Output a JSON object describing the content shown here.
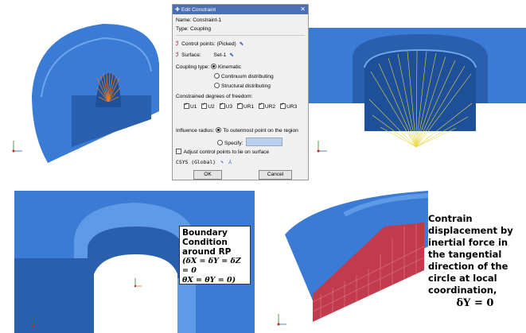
{
  "dialog": {
    "title": "Edit Constraint",
    "close_glyph": "✕",
    "name_label": "Name:",
    "name_value": "Constraint-1",
    "type_label": "Type:",
    "type_value": "Coupling",
    "control_points_label": "Control points:",
    "control_points_value": "(Picked)",
    "surface_label": "Surface:",
    "surface_value": "Set-1",
    "coupling_type_label": "Coupling type:",
    "coupling_options": [
      "Kinematic",
      "Continuum distributing",
      "Structural distributing"
    ],
    "coupling_selected_index": 0,
    "dof_label": "Constrained degrees of freedom:",
    "dof": [
      "U1",
      "U2",
      "U3",
      "UR1",
      "UR2",
      "UR3"
    ],
    "dof_checked": [
      true,
      true,
      true,
      true,
      true,
      true
    ],
    "influence_label": "Influence radius:",
    "influence_option_1": "To outermost point on the region",
    "influence_option_2": "Specify:",
    "influence_selected": 1,
    "adjust_label": "Adjust control points to lie on surface",
    "adjust_checked": false,
    "csys_label": "CSYS (Global)",
    "ok_label": "OK",
    "cancel_label": "Cancel"
  },
  "annotations": {
    "bc_lines": [
      "Boundary",
      "Condition",
      "around RP"
    ],
    "bc_eq_1": "(δX = δY = δZ = 0",
    "bc_eq_2": "θX = θY = 0)",
    "note_lines": [
      "Contrain",
      "displacement by",
      "inertial force in",
      "the tangential",
      "direction of the",
      "circle at local",
      "coordination,"
    ],
    "note_eq": "δY = 0"
  },
  "triad": {
    "x": "x",
    "y": "y",
    "z": "z"
  },
  "colors": {
    "model_blue": "#3a7bd5",
    "model_dark": "#2a5fae",
    "model_light": "#5f9ae6",
    "coupling_orange": "#e87a1e",
    "coupling_yellow": "#e8d84a",
    "constraint_red": "#c23b4c",
    "dialog_title": "#4b6fb5"
  }
}
